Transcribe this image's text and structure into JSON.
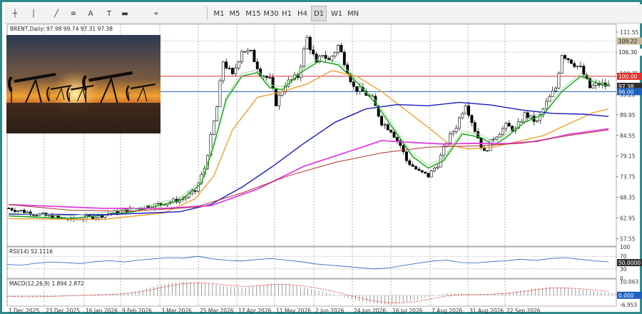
{
  "toolbar": {
    "timeframes": [
      "M1",
      "M5",
      "M15",
      "M30",
      "H1",
      "H4",
      "D1",
      "W1",
      "MN"
    ],
    "active": "D1",
    "tools": [
      "crosshair-icon",
      "line-icon",
      "trendline-icon",
      "fibonacci-icon",
      "text-icon",
      "text-label-icon",
      "rectangle-icon",
      "shapes-menu-icon"
    ]
  },
  "chart_data": {
    "type": "candlestick",
    "symbol_label": "BRENT,Daily",
    "ohlc_label": "97.98 99.74 97.31 97.38",
    "x_ticks": [
      "1 Dec 2025",
      "23 Dec 2025",
      "16 Jan 2026",
      "9 Feb 2026",
      "3 Mar 2026",
      "25 Mar 2026",
      "17 Apr 2026",
      "11 May 2026",
      "2 Jun 2026",
      "24 Jun 2026",
      "16 Jul 2026",
      "7 Aug 2026",
      "31 Aug 2026",
      "22 Sep 2026"
    ],
    "price_axis": {
      "ticks": [
        111.55,
        106.3,
        100.75,
        95.2,
        89.95,
        84.55,
        79.15,
        73.75,
        68.35,
        62.95,
        57.55
      ],
      "ylim": [
        55.6,
        113.6
      ],
      "labels_box": [
        {
          "value": 109.22,
          "text": "109.22",
          "color": "#c8b89a"
        },
        {
          "value": 106.3,
          "text": "106.30",
          "color": "#ffffff"
        },
        {
          "value": 100.0,
          "text": "100.00",
          "color": "#e03030"
        },
        {
          "value": 97.38,
          "text": "97.38",
          "color": "#303030"
        },
        {
          "value": 96.0,
          "text": "96.00",
          "color": "#1f5fbf"
        }
      ],
      "grid": false
    },
    "levels": [
      {
        "value": 109.22,
        "color": "#c8b89a",
        "style": "dotted"
      },
      {
        "value": 106.3,
        "color": "#b0b0b0",
        "style": "dotted"
      },
      {
        "value": 100.0,
        "color": "#e03030",
        "style": "solid"
      },
      {
        "value": 96.0,
        "color": "#1f5fbf",
        "style": "solid"
      }
    ],
    "price_path": [
      [
        0,
        65.5
      ],
      [
        12,
        63.5
      ],
      [
        20,
        62.5
      ],
      [
        28,
        63.4
      ],
      [
        36,
        64.8
      ],
      [
        48,
        66.5
      ],
      [
        56,
        68
      ],
      [
        60,
        70
      ],
      [
        63,
        76
      ],
      [
        65,
        84
      ],
      [
        67,
        92
      ],
      [
        69,
        104
      ],
      [
        72,
        100
      ],
      [
        75,
        107
      ],
      [
        78,
        106
      ],
      [
        81,
        101
      ],
      [
        84,
        99
      ],
      [
        86,
        93
      ],
      [
        89,
        98
      ],
      [
        93,
        100
      ],
      [
        96,
        110
      ],
      [
        99,
        103
      ],
      [
        101,
        106
      ],
      [
        103,
        104
      ],
      [
        106,
        108
      ],
      [
        108,
        104
      ],
      [
        111,
        97
      ],
      [
        114,
        96
      ],
      [
        117,
        94
      ],
      [
        120,
        88
      ],
      [
        123,
        86
      ],
      [
        126,
        82
      ],
      [
        128,
        78
      ],
      [
        132,
        75
      ],
      [
        135,
        74
      ],
      [
        138,
        77
      ],
      [
        141,
        83
      ],
      [
        144,
        87
      ],
      [
        147,
        93
      ],
      [
        150,
        86
      ],
      [
        153,
        80
      ],
      [
        156,
        84
      ],
      [
        160,
        87
      ],
      [
        163,
        86
      ],
      [
        166,
        90
      ],
      [
        170,
        88
      ],
      [
        173,
        93
      ],
      [
        176,
        97
      ],
      [
        178,
        106
      ],
      [
        181,
        104
      ],
      [
        184,
        102
      ],
      [
        187,
        97
      ],
      [
        190,
        98
      ],
      [
        193,
        97.4
      ]
    ],
    "series": [
      {
        "name": "",
        "color": "#23a823",
        "width": 1.6,
        "points": [
          [
            0,
            63.5
          ],
          [
            20,
            62.8
          ],
          [
            40,
            64.6
          ],
          [
            55,
            67.5
          ],
          [
            62,
            72
          ],
          [
            66,
            82
          ],
          [
            70,
            94
          ],
          [
            75,
            100
          ],
          [
            80,
            101
          ],
          [
            84,
            97
          ],
          [
            88,
            96.5
          ],
          [
            94,
            101
          ],
          [
            100,
            104
          ],
          [
            106,
            103
          ],
          [
            112,
            98.5
          ],
          [
            118,
            93
          ],
          [
            124,
            86
          ],
          [
            130,
            79
          ],
          [
            135,
            76
          ],
          [
            140,
            78
          ],
          [
            146,
            85
          ],
          [
            152,
            84
          ],
          [
            156,
            82
          ],
          [
            160,
            84
          ],
          [
            166,
            88
          ],
          [
            172,
            90
          ],
          [
            178,
            96
          ],
          [
            184,
            100
          ],
          [
            190,
            98
          ],
          [
            193,
            97.5
          ]
        ]
      },
      {
        "name": "",
        "color": "#f0a030",
        "width": 1.4,
        "points": [
          [
            0,
            62.8
          ],
          [
            30,
            62.6
          ],
          [
            50,
            64.3
          ],
          [
            60,
            68
          ],
          [
            66,
            74
          ],
          [
            72,
            86
          ],
          [
            80,
            94.5
          ],
          [
            88,
            96
          ],
          [
            96,
            98
          ],
          [
            104,
            101.5
          ],
          [
            112,
            100
          ],
          [
            120,
            96
          ],
          [
            128,
            91
          ],
          [
            136,
            86
          ],
          [
            142,
            82
          ],
          [
            148,
            81
          ],
          [
            156,
            81.5
          ],
          [
            164,
            83
          ],
          [
            172,
            84.5
          ],
          [
            180,
            87.5
          ],
          [
            188,
            90.5
          ],
          [
            193,
            91.5
          ]
        ]
      },
      {
        "name": "",
        "color": "#1a1ac0",
        "width": 1.4,
        "points": [
          [
            0,
            64
          ],
          [
            30,
            63.8
          ],
          [
            55,
            64.6
          ],
          [
            65,
            66.5
          ],
          [
            75,
            71
          ],
          [
            85,
            76.5
          ],
          [
            95,
            82.5
          ],
          [
            105,
            88
          ],
          [
            115,
            91.5
          ],
          [
            125,
            92.6
          ],
          [
            135,
            92.3
          ],
          [
            145,
            93.2
          ],
          [
            155,
            92.5
          ],
          [
            165,
            91.2
          ],
          [
            175,
            90.3
          ],
          [
            185,
            90.1
          ],
          [
            193,
            89.5
          ]
        ]
      },
      {
        "name": "",
        "color": "#e040e0",
        "width": 1.8,
        "points": [
          [
            0,
            66.5
          ],
          [
            30,
            65.5
          ],
          [
            50,
            65.5
          ],
          [
            65,
            66.2
          ],
          [
            80,
            70.5
          ],
          [
            95,
            76.5
          ],
          [
            110,
            80.5
          ],
          [
            120,
            83.2
          ],
          [
            130,
            82.7
          ],
          [
            140,
            82.3
          ],
          [
            150,
            82.5
          ],
          [
            160,
            82.4
          ],
          [
            170,
            83
          ],
          [
            180,
            84.8
          ],
          [
            193,
            86.3
          ]
        ]
      },
      {
        "name": "",
        "color": "#b03030",
        "width": 1,
        "points": [
          [
            0,
            66.5
          ],
          [
            20,
            65
          ],
          [
            40,
            64.8
          ],
          [
            60,
            65.8
          ],
          [
            75,
            69.5
          ],
          [
            90,
            74
          ],
          [
            105,
            77.5
          ],
          [
            120,
            80
          ],
          [
            135,
            81.5
          ],
          [
            150,
            81.8
          ],
          [
            165,
            82.5
          ],
          [
            180,
            84.5
          ],
          [
            193,
            86
          ]
        ]
      }
    ],
    "rsi": {
      "label": "RSI(14) 52.1116",
      "ticks_right": [
        "100",
        "70",
        "50.0000",
        "30",
        "0"
      ],
      "levels": [
        70,
        30
      ],
      "values": [
        44,
        42,
        48,
        52,
        50,
        47,
        53,
        56,
        52,
        58,
        62,
        66,
        64,
        70,
        62,
        57,
        55,
        60,
        63,
        58,
        53,
        46,
        42,
        38,
        34,
        30,
        33,
        41,
        48,
        55,
        58,
        50,
        49,
        53,
        56,
        61,
        57,
        63,
        66,
        61,
        56,
        52.1
      ]
    },
    "macd": {
      "label": "MACD(12,26,9) 1.894 2.872",
      "ticks_right": [
        "10.063",
        "0.000",
        "-6.953"
      ],
      "ylim": [
        -8,
        12
      ],
      "hist": [
        -1,
        -1.3,
        -1.2,
        -0.8,
        -0.3,
        0.2,
        0.5,
        0.8,
        1.5,
        3.5,
        6.5,
        9,
        10,
        9.5,
        8.5,
        6.5,
        5.5,
        7,
        8.6,
        8.2,
        6.5,
        4.2,
        1.5,
        -1.5,
        -4.2,
        -6,
        -6.8,
        -5.5,
        -3,
        -0.5,
        1.5,
        1.2,
        0.6,
        1,
        1.8,
        3.5,
        5,
        6.2,
        5.6,
        4.4,
        3,
        1.9
      ],
      "signal": [
        -0.8,
        -1.1,
        -1.1,
        -0.9,
        -0.5,
        -0.1,
        0.3,
        0.7,
        1.2,
        2.4,
        4.5,
        6.8,
        8.5,
        9.2,
        8.8,
        7.6,
        6.6,
        7,
        7.9,
        8.1,
        7.2,
        5.6,
        3.4,
        0.9,
        -1.9,
        -4.1,
        -5.6,
        -5.6,
        -4.4,
        -2.4,
        -0.4,
        0.5,
        0.6,
        0.8,
        1.4,
        2.6,
        4,
        5.3,
        5.5,
        4.9,
        3.9,
        2.9
      ]
    }
  }
}
